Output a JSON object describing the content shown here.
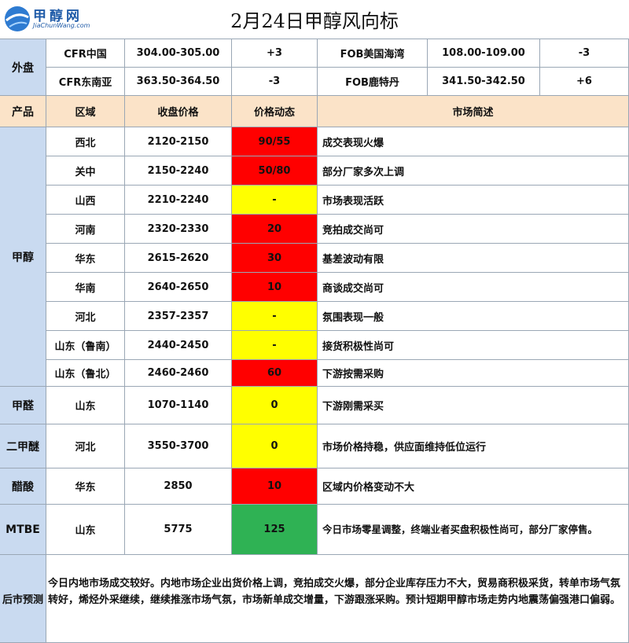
{
  "header": {
    "logo_text": "甲醇网",
    "logo_url_text": "JiaChunWang.com",
    "title": "2月24日甲醇风向标",
    "brand_color": "#1f5ba8"
  },
  "external": {
    "label": "外盘",
    "rows": [
      {
        "name1": "CFR中国",
        "price1": "304.00-305.00",
        "change1": "+3",
        "name2": "FOB美国海湾",
        "price2": "108.00-109.00",
        "change2": "-3"
      },
      {
        "name1": "CFR东南亚",
        "price1": "363.50-364.50",
        "change1": "-3",
        "name2": "FOB鹿特丹",
        "price2": "341.50-342.50",
        "change2": "+6"
      }
    ]
  },
  "table_header": {
    "product": "产品",
    "region": "区域",
    "close_price": "收盘价格",
    "dynamics": "价格动态",
    "summary": "市场简述"
  },
  "colors": {
    "up": "#ff0000",
    "flat": "#ffff00",
    "down": "#2fb254"
  },
  "products": {
    "methanol": {
      "name": "甲醇",
      "rows": [
        {
          "region": "西北",
          "price": "2120-2150",
          "dyn": "90/55",
          "status": "up",
          "summary": "成交表现火爆"
        },
        {
          "region": "关中",
          "price": "2150-2240",
          "dyn": "50/80",
          "status": "up",
          "summary": "部分厂家多次上调"
        },
        {
          "region": "山西",
          "price": "2210-2240",
          "dyn": "-",
          "status": "flat",
          "summary": "市场表现活跃"
        },
        {
          "region": "河南",
          "price": "2320-2330",
          "dyn": "20",
          "status": "up",
          "summary": "竞拍成交尚可"
        },
        {
          "region": "华东",
          "price": "2615-2620",
          "dyn": "30",
          "status": "up",
          "summary": "基差波动有限"
        },
        {
          "region": "华南",
          "price": "2640-2650",
          "dyn": "10",
          "status": "up",
          "summary": "商谈成交尚可"
        },
        {
          "region": "河北",
          "price": "2357-2357",
          "dyn": "-",
          "status": "flat",
          "summary": "氛围表现一般"
        },
        {
          "region": "山东（鲁南）",
          "price": "2440-2450",
          "dyn": "-",
          "status": "flat",
          "summary": "接货积极性尚可"
        },
        {
          "region": "山东（鲁北）",
          "price": "2460-2460",
          "dyn": "60",
          "status": "up",
          "summary": "下游按需采购"
        }
      ]
    },
    "formaldehyde": {
      "name": "甲醛",
      "region": "山东",
      "price": "1070-1140",
      "dyn": "0",
      "status": "flat",
      "summary": "下游刚需采买"
    },
    "dme": {
      "name": "二甲醚",
      "region": "河北",
      "price": "3550-3700",
      "dyn": "0",
      "status": "flat",
      "summary": "市场价格持稳，供应面维持低位运行"
    },
    "acetic": {
      "name": "醋酸",
      "region": "华东",
      "price": "2850",
      "dyn": "10",
      "status": "up",
      "summary": "区域内价格变动不大"
    },
    "mtbe": {
      "name": "MTBE",
      "region": "山东",
      "price": "5775",
      "dyn": "125",
      "status": "down",
      "summary": "今日市场零星调整，终端业者买盘积极性尚可，部分厂家停售。"
    }
  },
  "forecast": {
    "label": "后市预测",
    "text": "今日内地市场成交较好。内地市场企业出货价格上调，竞拍成交火爆，部分企业库存压力不大，贸易商积极采货，转单市场气氛转好，烯烃外采继续，继续推涨市场气氛，市场新单成交增量，下游跟涨采购。预计短期甲醇市场走势内地震荡偏强港口偏弱。"
  }
}
